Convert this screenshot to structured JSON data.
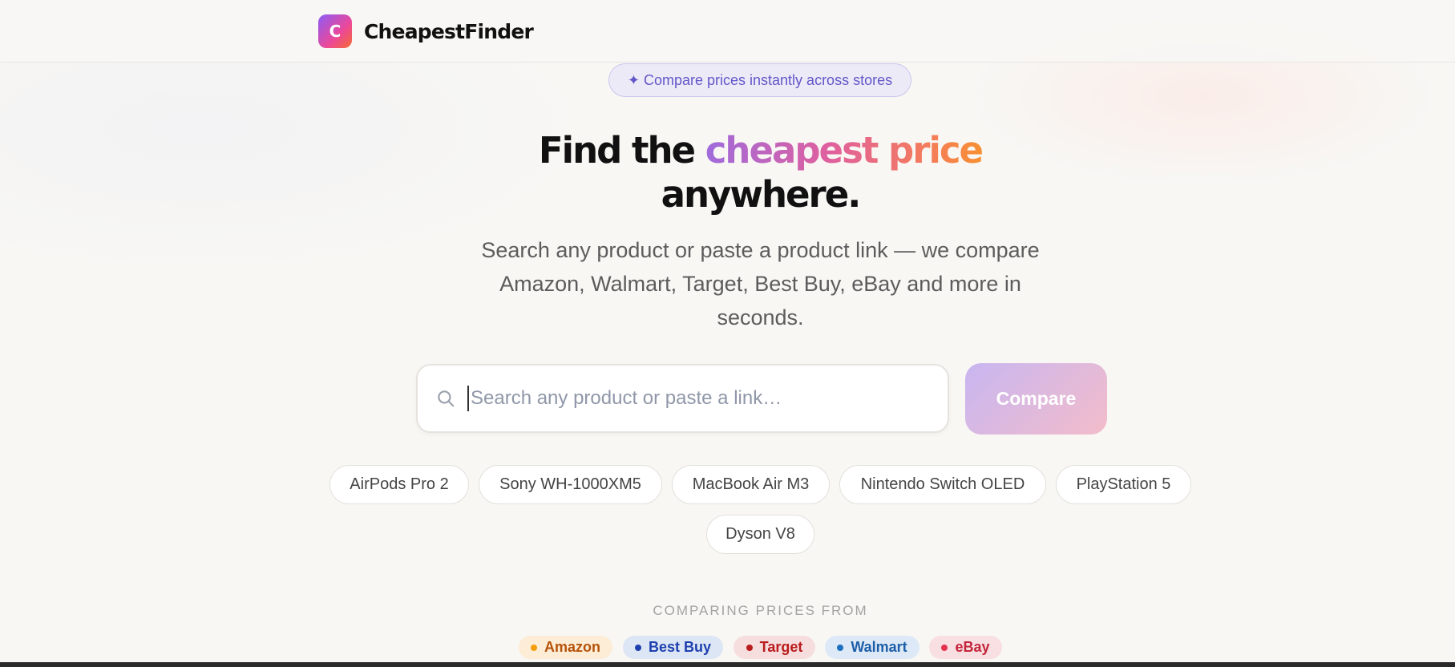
{
  "brand": {
    "logo_letter": "C",
    "name": "CheapestFinder"
  },
  "hero": {
    "tagline": "✦ Compare prices instantly across stores",
    "headline_part1": "Find the",
    "headline_highlight": "cheapest price",
    "headline_part2": "anywhere.",
    "subtitle": "Search any product or paste a product link — we compare Amazon, Walmart, Target, Best Buy, eBay and more in seconds."
  },
  "search": {
    "placeholder": "Search any product or paste a link…",
    "value": "",
    "icon": "search-icon",
    "button_label": "Compare"
  },
  "suggestions": [
    "AirPods Pro 2",
    "Sony WH-1000XM5",
    "MacBook Air M3",
    "Nintendo Switch OLED",
    "PlayStation 5",
    "Dyson V8"
  ],
  "stores": {
    "label": "COMPARING PRICES FROM",
    "items": [
      {
        "name": "Amazon",
        "color": "#b45309",
        "bg": "#fdecd6",
        "dot": "#f59e0b"
      },
      {
        "name": "Best Buy",
        "color": "#1e40af",
        "bg": "#dde6f5",
        "dot": "#1e40af"
      },
      {
        "name": "Target",
        "color": "#b91c1c",
        "bg": "#f7dede",
        "dot": "#b91c1c"
      },
      {
        "name": "Walmart",
        "color": "#1d5ea8",
        "bg": "#dde9f6",
        "dot": "#1d6fc0"
      },
      {
        "name": "eBay",
        "color": "#c2263a",
        "bg": "#f8dfe2",
        "dot": "#e53250"
      }
    ]
  }
}
